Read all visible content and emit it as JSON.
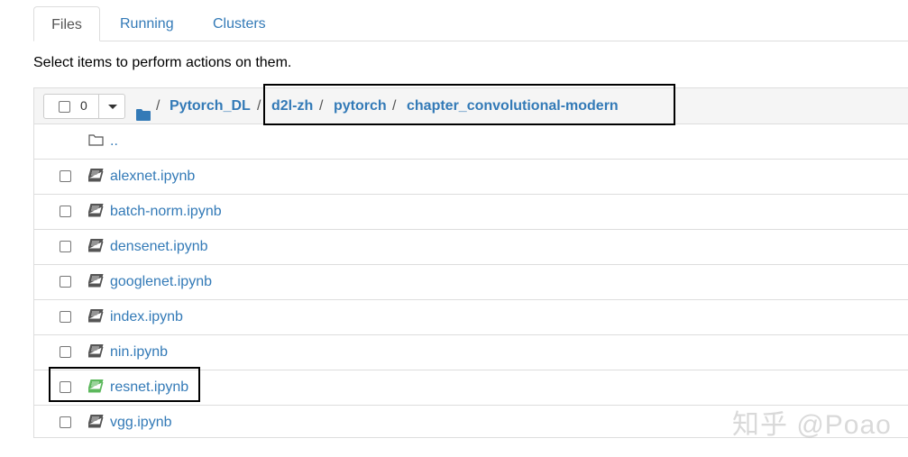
{
  "tabs": [
    {
      "label": "Files",
      "active": true
    },
    {
      "label": "Running",
      "active": false
    },
    {
      "label": "Clusters",
      "active": false
    }
  ],
  "instructions": "Select items to perform actions on them.",
  "selection": {
    "count": "0"
  },
  "breadcrumb": {
    "icon": "folder-icon",
    "separator": "/",
    "items": [
      "Pytorch_DL",
      "d2l-zh",
      "pytorch",
      "chapter_convolutional-modern"
    ]
  },
  "parent_dir": {
    "label": "..",
    "icon": "folder-outline-icon"
  },
  "files": [
    {
      "name": "alexnet.ipynb",
      "running": false
    },
    {
      "name": "batch-norm.ipynb",
      "running": false
    },
    {
      "name": "densenet.ipynb",
      "running": false
    },
    {
      "name": "googlenet.ipynb",
      "running": false
    },
    {
      "name": "index.ipynb",
      "running": false
    },
    {
      "name": "nin.ipynb",
      "running": false
    },
    {
      "name": "resnet.ipynb",
      "running": true
    },
    {
      "name": "vgg.ipynb",
      "running": false
    }
  ],
  "colors": {
    "link": "#337ab7",
    "notebook_idle": "#555555",
    "notebook_running": "#5cb85c",
    "header_bg": "#f5f5f5",
    "border": "#dddddd"
  },
  "watermark": "知乎 @Poao"
}
